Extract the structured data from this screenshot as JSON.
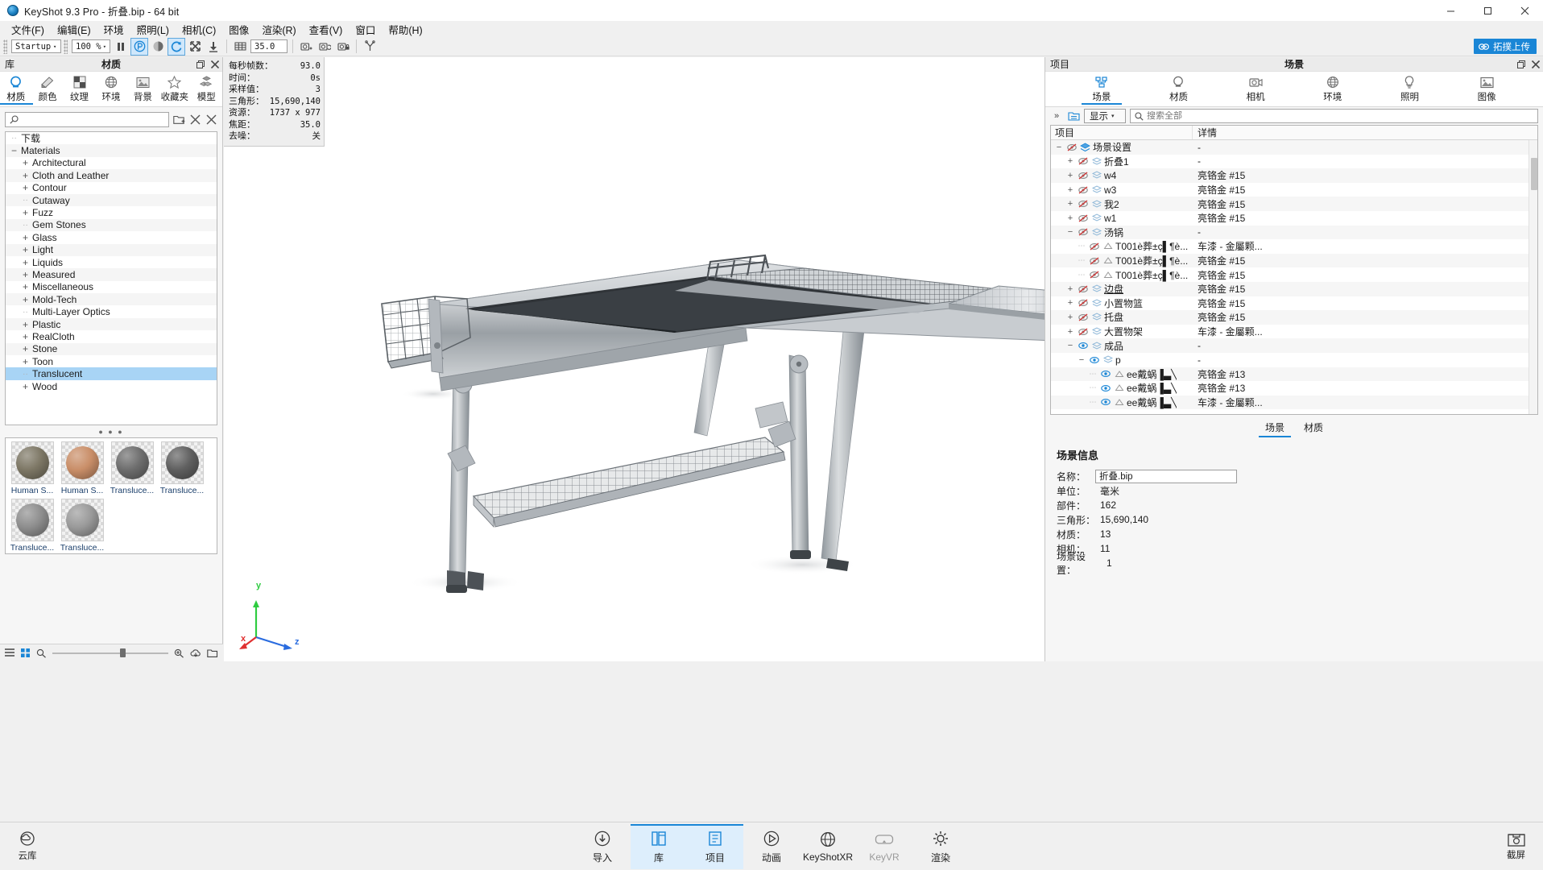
{
  "titlebar": {
    "title": "KeyShot 9.3 Pro  - 折叠.bip  - 64 bit",
    "minimize": "─",
    "maximize": "□",
    "close": "✕"
  },
  "menubar": {
    "items": [
      {
        "label": "文件(F)"
      },
      {
        "label": "编辑(E)"
      },
      {
        "label": "环境"
      },
      {
        "label": "照明(L)"
      },
      {
        "label": "相机(C)"
      },
      {
        "label": "图像"
      },
      {
        "label": "渲染(R)"
      },
      {
        "label": "查看(V)"
      },
      {
        "label": "窗口"
      },
      {
        "label": "帮助(H)"
      }
    ]
  },
  "toolbar": {
    "preset": "Startup",
    "zoom": "100 %",
    "focal": "35.0",
    "upload_label": "拓撲上传",
    "arrow": "▾"
  },
  "library": {
    "head_left": "库",
    "head_center": "材质",
    "tabs": [
      {
        "label": "材质",
        "icon": "material-ball-icon",
        "selected": true
      },
      {
        "label": "颜色",
        "icon": "color-swatch-icon",
        "selected": false
      },
      {
        "label": "纹理",
        "icon": "texture-checker-icon",
        "selected": false
      },
      {
        "label": "环境",
        "icon": "globe-icon",
        "selected": false
      },
      {
        "label": "背景",
        "icon": "image-icon",
        "selected": false
      },
      {
        "label": "收藏夹",
        "icon": "star-icon",
        "selected": false
      },
      {
        "label": "模型",
        "icon": "cubes-icon",
        "selected": false
      }
    ],
    "search_placeholder": "",
    "tree": [
      {
        "label": "下载",
        "state": "leaf",
        "indent": 0,
        "selected": false
      },
      {
        "label": "Materials",
        "state": "minus",
        "indent": 0,
        "selected": false
      },
      {
        "label": "Architectural",
        "state": "plus",
        "indent": 1,
        "selected": false
      },
      {
        "label": "Cloth and Leather",
        "state": "plus",
        "indent": 1,
        "selected": false
      },
      {
        "label": "Contour",
        "state": "plus",
        "indent": 1,
        "selected": false
      },
      {
        "label": "Cutaway",
        "state": "leaf",
        "indent": 1,
        "selected": false
      },
      {
        "label": "Fuzz",
        "state": "plus",
        "indent": 1,
        "selected": false
      },
      {
        "label": "Gem Stones",
        "state": "leaf",
        "indent": 1,
        "selected": false
      },
      {
        "label": "Glass",
        "state": "plus",
        "indent": 1,
        "selected": false
      },
      {
        "label": "Light",
        "state": "plus",
        "indent": 1,
        "selected": false
      },
      {
        "label": "Liquids",
        "state": "plus",
        "indent": 1,
        "selected": false
      },
      {
        "label": "Measured",
        "state": "plus",
        "indent": 1,
        "selected": false
      },
      {
        "label": "Miscellaneous",
        "state": "plus",
        "indent": 1,
        "selected": false
      },
      {
        "label": "Mold-Tech",
        "state": "plus",
        "indent": 1,
        "selected": false
      },
      {
        "label": "Multi-Layer Optics",
        "state": "leaf",
        "indent": 1,
        "selected": false
      },
      {
        "label": "Plastic",
        "state": "plus",
        "indent": 1,
        "selected": false
      },
      {
        "label": "RealCloth",
        "state": "plus",
        "indent": 1,
        "selected": false
      },
      {
        "label": "Stone",
        "state": "plus",
        "indent": 1,
        "selected": false
      },
      {
        "label": "Toon",
        "state": "plus",
        "indent": 1,
        "selected": false
      },
      {
        "label": "Translucent",
        "state": "leaf",
        "indent": 1,
        "selected": true
      },
      {
        "label": "Wood",
        "state": "plus",
        "indent": 1,
        "selected": false
      }
    ],
    "thumbnails": [
      {
        "label": "Human S...",
        "color": "#7d7765"
      },
      {
        "label": "Human S...",
        "color": "#c98e68"
      },
      {
        "label": "Transluce...",
        "color": "#6d6d6d"
      },
      {
        "label": "Transluce...",
        "color": "#5f5f5f"
      },
      {
        "label": "Transluce...",
        "color": "#8e8e8e"
      },
      {
        "label": "Transluce...",
        "color": "#9a9a9a"
      }
    ],
    "statusbar": {
      "list_icon": "list-view-icon",
      "grid_icon": "grid-view-icon",
      "zoom_out_icon": "zoom-out-icon",
      "zoom_in_icon": "zoom-in-icon",
      "cloud_icon": "cloud-download-icon",
      "folder_icon": "folder-open-icon"
    }
  },
  "viewport": {
    "hud": [
      {
        "key": "每秒帧数：",
        "value": "93.0"
      },
      {
        "key": "时间：",
        "value": "0s"
      },
      {
        "key": "采样值：",
        "value": "3"
      },
      {
        "key": "三角形：",
        "value": "15,690,140"
      },
      {
        "key": "资源：",
        "value": "1737 x 977"
      },
      {
        "key": "焦距：",
        "value": "35.0"
      },
      {
        "key": "去噪：",
        "value": "关"
      }
    ],
    "axis": {
      "x": "x",
      "y": "y",
      "z": "z"
    }
  },
  "project": {
    "head_left": "项目",
    "head_center": "场景",
    "tabs": [
      {
        "label": "场景",
        "icon": "scene-tree-icon",
        "selected": true
      },
      {
        "label": "材质",
        "icon": "material-ball-icon",
        "selected": false
      },
      {
        "label": "相机",
        "icon": "camera-icon",
        "selected": false
      },
      {
        "label": "环境",
        "icon": "globe-icon",
        "selected": false
      },
      {
        "label": "照明",
        "icon": "light-bulb-icon",
        "selected": false
      },
      {
        "label": "图像",
        "icon": "image-icon",
        "selected": false
      }
    ],
    "showbar": {
      "chevron": "»",
      "tree_icon": "tree-toggle-icon",
      "display_label": "显示",
      "search_placeholder": "搜索全部"
    },
    "tree_headers": {
      "name": "项目",
      "detail": "详情"
    },
    "tree_rows": [
      {
        "label": "场景设置",
        "detail": "-",
        "indent": 0,
        "state": "minus",
        "type": "scene-icon",
        "vis": "hidden",
        "underline": false
      },
      {
        "label": "折叠1",
        "detail": "-",
        "indent": 1,
        "state": "plus",
        "type": "group-icon",
        "vis": "hidden",
        "underline": false
      },
      {
        "label": "w4",
        "detail": "亮铬金 #15",
        "indent": 1,
        "state": "plus",
        "type": "group-icon",
        "vis": "hidden",
        "underline": false
      },
      {
        "label": "w3",
        "detail": "亮铬金 #15",
        "indent": 1,
        "state": "plus",
        "type": "group-icon",
        "vis": "hidden",
        "underline": false
      },
      {
        "label": "我2",
        "detail": "亮铬金 #15",
        "indent": 1,
        "state": "plus",
        "type": "group-icon",
        "vis": "hidden",
        "underline": false
      },
      {
        "label": "w1",
        "detail": "亮铬金 #15",
        "indent": 1,
        "state": "plus",
        "type": "group-icon",
        "vis": "hidden",
        "underline": false
      },
      {
        "label": "汤锅",
        "detail": "-",
        "indent": 1,
        "state": "minus",
        "type": "group-icon",
        "vis": "hidden",
        "underline": false
      },
      {
        "label": "T001è葬±ç▌¶è...",
        "detail": "车漆 - 金屬颗...",
        "indent": 2,
        "state": "leaf",
        "type": "part-icon",
        "vis": "hidden",
        "underline": false
      },
      {
        "label": "T001è葬±ç▌¶è...",
        "detail": "亮铬金 #15",
        "indent": 2,
        "state": "leaf",
        "type": "part-icon",
        "vis": "hidden",
        "underline": false
      },
      {
        "label": "T001è葬±ç▌¶è...",
        "detail": "亮铬金 #15",
        "indent": 2,
        "state": "leaf",
        "type": "part-icon",
        "vis": "hidden",
        "underline": false
      },
      {
        "label": "边盘",
        "detail": "亮铬金 #15",
        "indent": 1,
        "state": "plus",
        "type": "group-icon",
        "vis": "hidden",
        "underline": true
      },
      {
        "label": "小置物篮",
        "detail": "亮铬金 #15",
        "indent": 1,
        "state": "plus",
        "type": "group-icon",
        "vis": "hidden",
        "underline": false
      },
      {
        "label": "托盘",
        "detail": "亮铬金 #15",
        "indent": 1,
        "state": "plus",
        "type": "group-icon",
        "vis": "hidden",
        "underline": false
      },
      {
        "label": "大置物架",
        "detail": "车漆 - 金屬颗...",
        "indent": 1,
        "state": "plus",
        "type": "group-icon",
        "vis": "hidden",
        "underline": false
      },
      {
        "label": "成品",
        "detail": "-",
        "indent": 1,
        "state": "minus",
        "type": "group-icon",
        "vis": "visible",
        "underline": false
      },
      {
        "label": "p",
        "detail": "-",
        "indent": 2,
        "state": "minus",
        "type": "group-icon",
        "vis": "visible",
        "underline": false
      },
      {
        "label": "ee戴蜗▐▃╲",
        "detail": "亮铬金 #13",
        "indent": 3,
        "state": "leaf",
        "type": "part-icon",
        "vis": "visible",
        "underline": false
      },
      {
        "label": "ee戴蜗▐▃╲",
        "detail": "亮铬金 #13",
        "indent": 3,
        "state": "leaf",
        "type": "part-icon",
        "vis": "visible",
        "underline": false
      },
      {
        "label": "ee戴蜗▐▃╲",
        "detail": "车漆 - 金屬颗...",
        "indent": 3,
        "state": "leaf",
        "type": "part-icon",
        "vis": "visible",
        "underline": false
      }
    ],
    "bottom_tabs": [
      {
        "label": "场景",
        "selected": true
      },
      {
        "label": "材质",
        "selected": false
      }
    ],
    "scene_info": {
      "title": "场景信息",
      "rows": [
        {
          "key": "名称：",
          "value": "折叠.bip",
          "input": true
        },
        {
          "key": "单位：",
          "value": "毫米",
          "input": false
        },
        {
          "key": "部件：",
          "value": "162",
          "input": false
        },
        {
          "key": "三角形：",
          "value": "15,690,140",
          "input": false
        },
        {
          "key": "材质：",
          "value": "13",
          "input": false
        },
        {
          "key": "相机：",
          "value": "11",
          "input": false
        },
        {
          "key": "场景设置：",
          "value": "1",
          "input": false
        }
      ]
    }
  },
  "bottombar": {
    "items": [
      {
        "label": "导入",
        "icon": "import-icon",
        "selected": false
      },
      {
        "label": "库",
        "icon": "library-icon",
        "selected": true
      },
      {
        "label": "项目",
        "icon": "project-icon",
        "selected": true
      },
      {
        "label": "动画",
        "icon": "animation-icon",
        "selected": false
      },
      {
        "label": "KeyShotXR",
        "icon": "keyshotxr-icon",
        "selected": false
      },
      {
        "label": "KeyVR",
        "icon": "keyvr-icon",
        "selected": false
      },
      {
        "label": "渲染",
        "icon": "render-icon",
        "selected": false
      }
    ],
    "left_corner": {
      "label": "云库",
      "icon": "cloud-icon"
    },
    "right_corner": {
      "label": "截屏",
      "icon": "screenshot-icon"
    }
  },
  "colors": {
    "accent": "#1a86d6",
    "selection": "#a8d4f5",
    "panel_bg": "#f6f6f6",
    "toolbar_bg": "#f0f0f0"
  }
}
